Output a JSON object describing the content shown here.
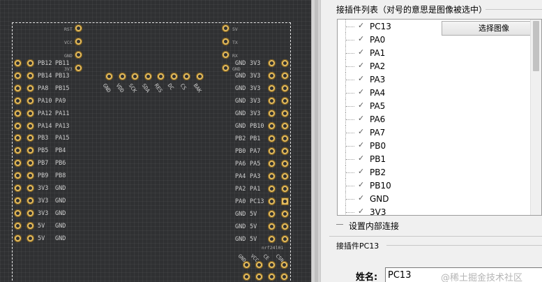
{
  "pcb": {
    "top_header_labels": [
      "RST",
      "VCC",
      "GND",
      "3V3"
    ],
    "top_right_labels": [
      "5V",
      "TX",
      "RX",
      "GND"
    ],
    "left_rows": [
      [
        "PB12",
        "PB11"
      ],
      [
        "PB14",
        "PB13"
      ],
      [
        "PA8",
        "PB15"
      ],
      [
        "PA10",
        "PA9"
      ],
      [
        "PA12",
        "PA11"
      ],
      [
        "PA14",
        "PA13"
      ],
      [
        "PB3",
        "PA15"
      ],
      [
        "PB5",
        "PB4"
      ],
      [
        "PB7",
        "PB6"
      ],
      [
        "PB9",
        "PB8"
      ],
      [
        "3V3",
        "GND"
      ],
      [
        "3V3",
        "GND"
      ],
      [
        "3V3",
        "GND"
      ],
      [
        "5V",
        "GND"
      ],
      [
        "5V",
        "GND"
      ]
    ],
    "right_rows": [
      [
        "GND",
        "3V3"
      ],
      [
        "GND",
        "3V3"
      ],
      [
        "GND",
        "3V3"
      ],
      [
        "GND",
        "3V3"
      ],
      [
        "GND",
        "3V3"
      ],
      [
        "GND",
        "PB10"
      ],
      [
        "PB2",
        "PB1"
      ],
      [
        "PB0",
        "PA7"
      ],
      [
        "PA6",
        "PA5"
      ],
      [
        "PA4",
        "PA3"
      ],
      [
        "PA2",
        "PA1"
      ],
      [
        "PA0",
        "PC13"
      ],
      [
        "GND",
        "5V"
      ],
      [
        "GND",
        "5V"
      ],
      [
        "GND",
        "5V"
      ]
    ],
    "middle_header_labels": [
      "GND",
      "VDD",
      "SCK",
      "SDA",
      "RES",
      "DC",
      "CS",
      "BAK"
    ],
    "module_label": "nrf24l01",
    "module_pin_labels": [
      "GND",
      "VCC",
      "CE",
      "CSN"
    ]
  },
  "panel": {
    "title": "接插件列表（对号的意思是图像被选中）",
    "select_image_button": "选择图像",
    "connectors": [
      {
        "label": "PC13",
        "checked": true
      },
      {
        "label": "PA0",
        "checked": true
      },
      {
        "label": "PA1",
        "checked": true
      },
      {
        "label": "PA2",
        "checked": true
      },
      {
        "label": "PA3",
        "checked": true
      },
      {
        "label": "PA4",
        "checked": true
      },
      {
        "label": "PA5",
        "checked": true
      },
      {
        "label": "PA6",
        "checked": true
      },
      {
        "label": "PA7",
        "checked": true
      },
      {
        "label": "PB0",
        "checked": true
      },
      {
        "label": "PB1",
        "checked": true
      },
      {
        "label": "PB2",
        "checked": true
      },
      {
        "label": "PB10",
        "checked": true
      },
      {
        "label": "GND",
        "checked": true
      },
      {
        "label": "3V3",
        "checked": true
      }
    ],
    "check_glyph": "✓",
    "internal_connection_label": "设置内部连接",
    "detail_title": "接插件PC13",
    "name_label": "姓名:",
    "name_value": "PC13",
    "watermark": "@稀土掘金技术社区"
  }
}
